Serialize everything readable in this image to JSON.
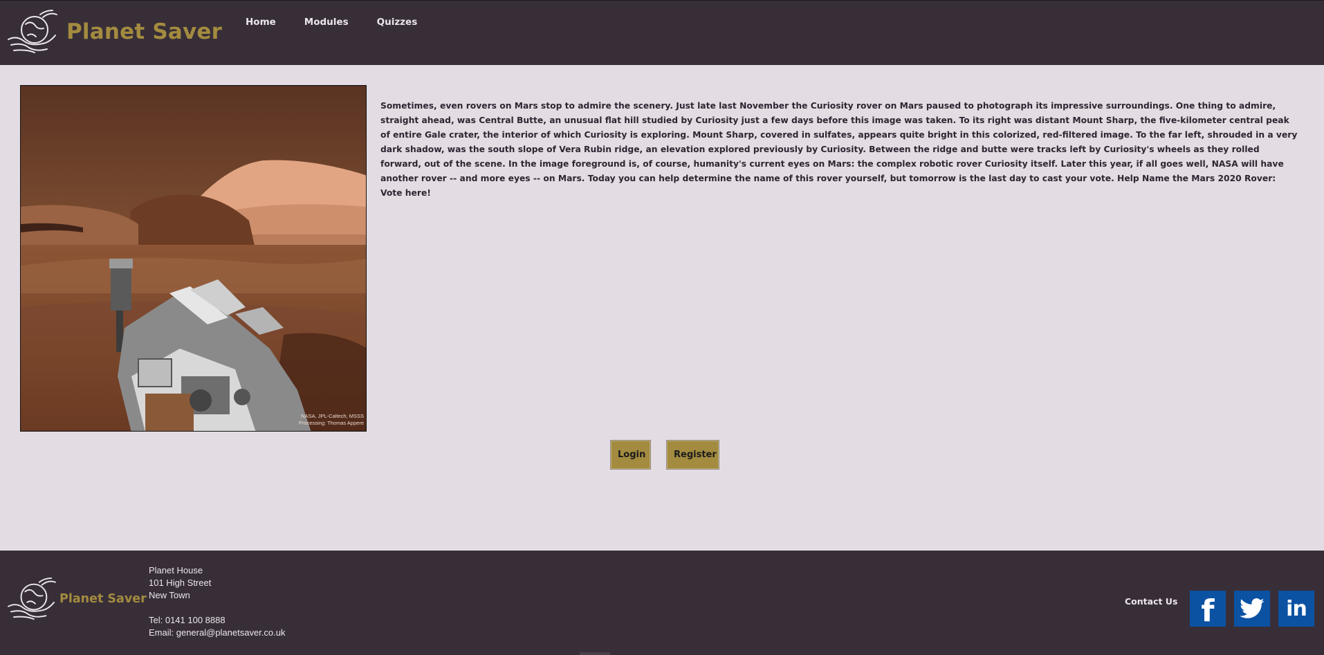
{
  "header": {
    "brand_name": "Planet Saver",
    "nav": [
      {
        "label": "Home"
      },
      {
        "label": "Modules"
      },
      {
        "label": "Quizzes"
      }
    ]
  },
  "main": {
    "image": {
      "icon": "mars-curiosity-photo",
      "credit_line1": "NASA, JPL-Caltech, MSSS",
      "credit_line2": "Processing: Thomas Appere"
    },
    "article_text": "Sometimes, even rovers on Mars stop to admire the scenery. Just late last November the Curiosity rover on Mars paused to photograph its impressive surroundings. One thing to admire, straight ahead, was Central Butte, an unusual flat hill studied by Curiosity just a few days before this image was taken. To its right was distant Mount Sharp, the five-kilometer central peak of entire Gale crater, the interior of which Curiosity is exploring. Mount Sharp, covered in sulfates, appears quite bright in this colorized, red-filtered image. To the far left, shrouded in a very dark shadow, was the south slope of Vera Rubin ridge, an elevation explored previously by Curiosity. Between the ridge and butte were tracks left by Curiosity's wheels as they rolled forward, out of the scene. In the image foreground is, of course, humanity's current eyes on Mars: the complex robotic rover Curiosity itself. Later this year, if all goes well, NASA will have another rover -- and more eyes -- on Mars. Today you can help determine the name of this rover yourself, but tomorrow is the last day to cast your vote. Help Name the Mars 2020 Rover: Vote here!",
    "buttons": {
      "login": "Login",
      "register": "Register"
    }
  },
  "footer": {
    "brand_name": "Planet Saver",
    "address": {
      "line1": "Planet House",
      "line2": "101 High Street",
      "line3": "New Town",
      "tel": "Tel: 0141 100 8888",
      "email": "Email: general@planetsaver.co.uk"
    },
    "contact_label": "Contact Us",
    "social": [
      {
        "name": "facebook",
        "glyph": "f"
      },
      {
        "name": "twitter",
        "glyph": ""
      },
      {
        "name": "linkedin",
        "glyph": "in"
      }
    ]
  },
  "colors": {
    "header_bg": "#382e38",
    "page_bg": "#e4dce3",
    "brand_gold": "#a38b3f",
    "social_blue": "#0b52a3"
  }
}
